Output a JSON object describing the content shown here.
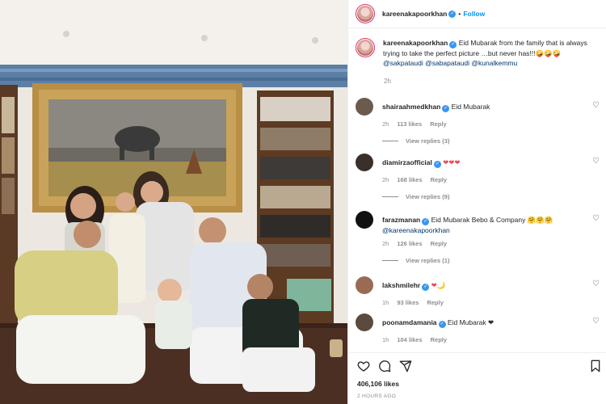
{
  "post": {
    "username": "kareenakapoorkhan",
    "verified_badge": "✓",
    "dot": "•",
    "follow_label": "Follow",
    "caption": {
      "text": "Eid Mubarak from the family that is always trying to take the perfect picture …but never has!!!",
      "emojis": "🤪🤪🤪",
      "mentions": "@sakpataudi @sabapataudi @kunalkemmu",
      "time": "2h"
    },
    "likes_total": "406,106 likes",
    "posted_ago": "2 HOURS AGO"
  },
  "comments": [
    {
      "user": "shairaahmedkhan",
      "verified": true,
      "text": "Eid Mubarak",
      "time": "2h",
      "likes": "113 likes",
      "reply": "Reply",
      "view_replies": "View replies (3)",
      "avatar_color": "#6b5a4e"
    },
    {
      "user": "diamirzaofficial",
      "verified": true,
      "text": "❤❤❤",
      "time": "2h",
      "likes": "168 likes",
      "reply": "Reply",
      "view_replies": "View replies (9)",
      "avatar_color": "#3b2f2a"
    },
    {
      "user": "farazmanan",
      "verified": true,
      "text": "Eid Mubarak Bebo & Company 🤗🤗🤗",
      "mention": "@kareenakapoorkhan",
      "time": "2h",
      "likes": "126 likes",
      "reply": "Reply",
      "view_replies": "View replies (1)",
      "avatar_color": "#111111"
    },
    {
      "user": "lakshmilehr",
      "verified": true,
      "text": "❤🌙",
      "time": "1h",
      "likes": "93 likes",
      "reply": "Reply",
      "avatar_color": "#9a6a55"
    },
    {
      "user": "poonamdamania",
      "verified": true,
      "text": "Eid Mubarak ❤",
      "time": "1h",
      "likes": "104 likes",
      "reply": "Reply",
      "avatar_color": "#5b4a3e"
    }
  ],
  "icons": {
    "like": "heart-icon",
    "comment": "comment-icon",
    "share": "share-icon",
    "save": "bookmark-icon"
  },
  "colors": {
    "link": "#0095f6",
    "verified": "#3897f0",
    "heart_red": "#ed4956",
    "muted": "#8e8e8e"
  }
}
